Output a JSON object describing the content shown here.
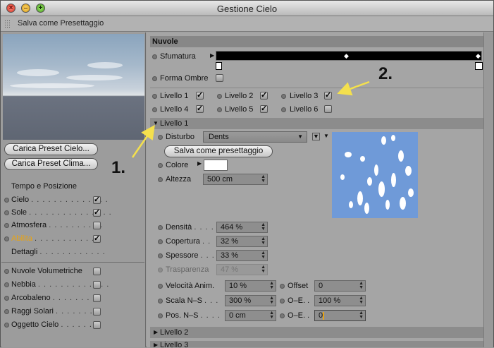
{
  "window": {
    "title": "Gestione Cielo"
  },
  "toolbar": {
    "label": "Salva come Presettaggio"
  },
  "left": {
    "buttons": {
      "load_sky": "Carica Preset Cielo...",
      "load_climate": "Carica Preset Clima..."
    },
    "section1": "Tempo e Posizione",
    "items1": [
      {
        "label": "Cielo",
        "dots": ". . . . . . . . . . . . . .",
        "checked": "✓"
      },
      {
        "label": "Sole",
        "dots": ". . . . . . . . . . . . . . .",
        "checked": "✓"
      },
      {
        "label": "Atmosfera",
        "dots": ". . . . . . . . . .",
        "checked": ""
      },
      {
        "label": "Abilita",
        "dots": ". . . . . . . . . . . .",
        "checked": "✓"
      },
      {
        "label": "Dettagli",
        "dots": ". . . . . . . . . . . .",
        "checked": ""
      }
    ],
    "items2": [
      {
        "label": "Nuvole Volumetriche",
        "checked": ""
      },
      {
        "label": "Nebbia",
        "dots": ". . . . . . . . . . . . .",
        "checked": ""
      },
      {
        "label": "Arcobaleno",
        "dots": ". . . . . . . . .",
        "checked": ""
      },
      {
        "label": "Raggi Solari",
        "dots": ". . . . . . . .",
        "checked": ""
      },
      {
        "label": "Oggetto Cielo",
        "dots": ". . . . . .",
        "checked": ""
      }
    ]
  },
  "right": {
    "header": "Nuvole",
    "sfumatura": "Sfumatura",
    "forma_ombre": "Forma Ombre",
    "levels": [
      {
        "label": "Livello 1",
        "check": "✓"
      },
      {
        "label": "Livello 2",
        "check": "✓"
      },
      {
        "label": "Livello 3",
        "check": "✓"
      },
      {
        "label": "Livello 4",
        "check": "✓"
      },
      {
        "label": "Livello 5",
        "check": "✓"
      },
      {
        "label": "Livello 6",
        "check": ""
      }
    ],
    "group1": "Livello 1",
    "disturbo": {
      "label": "Disturbo",
      "value": "Dents"
    },
    "save_preset": "Salva come presettaggio",
    "colore": "Colore",
    "altezza": {
      "label": "Altezza",
      "value": "500 cm"
    },
    "densita": {
      "label": "Densità",
      "dots": ". . . .",
      "value": "464 %"
    },
    "copertura": {
      "label": "Copertura",
      "dots": ". .",
      "value": "32 %"
    },
    "spessore": {
      "label": "Spessore",
      "dots": ". . .",
      "value": "33 %"
    },
    "trasparenza": {
      "label": "Trasparenza",
      "value": "47 %"
    },
    "velocita": {
      "label": "Velocità Anim.",
      "value": "10 %"
    },
    "offset": {
      "label": "Offset",
      "value": "0"
    },
    "scala": {
      "label": "Scala N–S",
      "dots": ". . .",
      "value": "300 %"
    },
    "oe1": {
      "label": "O–E. .",
      "value": "100 %"
    },
    "pos": {
      "label": "Pos. N–S",
      "dots": ". . . .",
      "value": "0 cm"
    },
    "oe2": {
      "label": "O–E. .",
      "value": "0"
    },
    "group2": "Livello 2",
    "group3": "Livello 3"
  },
  "annotations": {
    "a1": "1.",
    "a2": "2."
  },
  "colors": {
    "accent": "#e8a313",
    "arrow": "#f4e04d",
    "noise": "#6f9ad8"
  }
}
